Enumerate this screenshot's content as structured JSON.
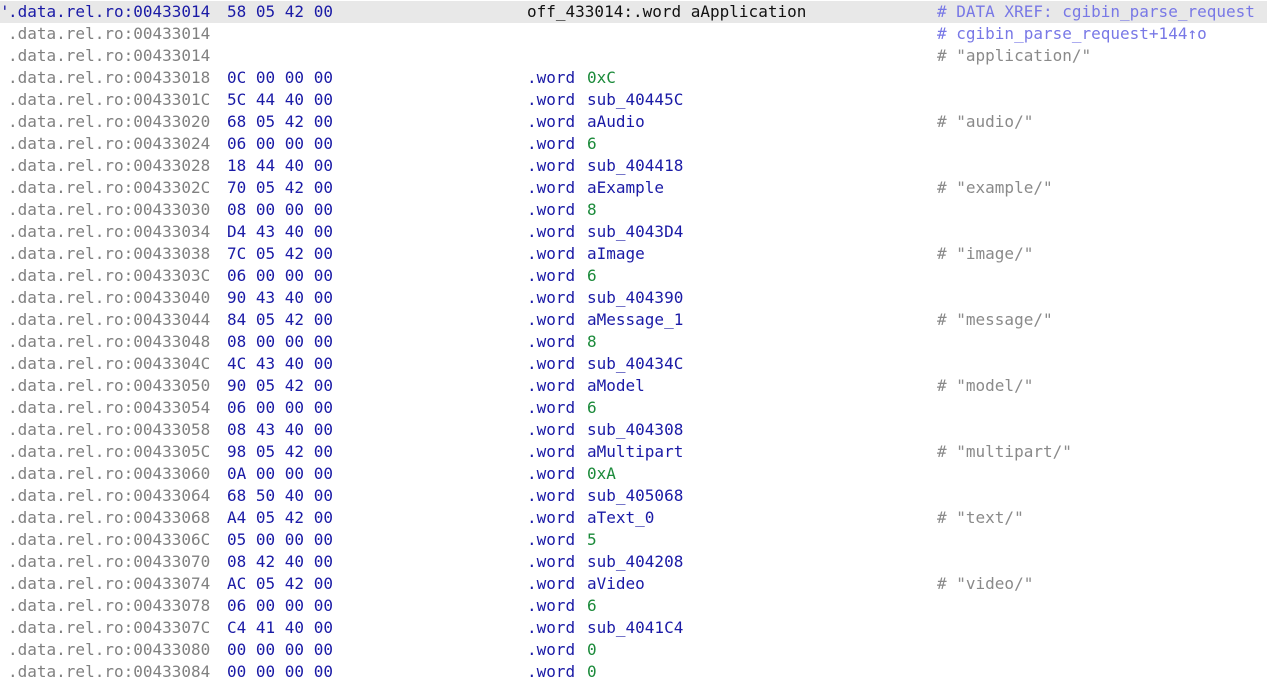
{
  "colors": {
    "address": "#808080",
    "bytes": "#1a1aa6",
    "mnemonic": "#1a1aa6",
    "number_operand": "#1b8a3a",
    "symbol_operand": "#1a1aa6",
    "comment": "#8a8a8a",
    "xref_comment": "#7878e6",
    "selected_row_bg": "#e8e8e8"
  },
  "listing": {
    "rows": [
      {
        "caret": "'",
        "addr": ".data.rel.ro:00433014",
        "bytes": "58 05 42 00",
        "label": "off_433014:.word aApplication",
        "comment": "# DATA XREF: cgibin_parse_request"
      },
      {
        "addr": ".data.rel.ro:00433014",
        "comment": "# cgibin_parse_request+144↑o"
      },
      {
        "addr": ".data.rel.ro:00433014",
        "comment": "# \"application/\""
      },
      {
        "addr": ".data.rel.ro:00433018",
        "bytes": "0C 00 00 00",
        "mnem": ".word",
        "op": "0xC"
      },
      {
        "addr": ".data.rel.ro:0043301C",
        "bytes": "5C 44 40 00",
        "mnem": ".word",
        "op": "sub_40445C"
      },
      {
        "addr": ".data.rel.ro:00433020",
        "bytes": "68 05 42 00",
        "mnem": ".word",
        "op": "aAudio",
        "comment": "# \"audio/\""
      },
      {
        "addr": ".data.rel.ro:00433024",
        "bytes": "06 00 00 00",
        "mnem": ".word",
        "op": "6"
      },
      {
        "addr": ".data.rel.ro:00433028",
        "bytes": "18 44 40 00",
        "mnem": ".word",
        "op": "sub_404418"
      },
      {
        "addr": ".data.rel.ro:0043302C",
        "bytes": "70 05 42 00",
        "mnem": ".word",
        "op": "aExample",
        "comment": "# \"example/\""
      },
      {
        "addr": ".data.rel.ro:00433030",
        "bytes": "08 00 00 00",
        "mnem": ".word",
        "op": "8"
      },
      {
        "addr": ".data.rel.ro:00433034",
        "bytes": "D4 43 40 00",
        "mnem": ".word",
        "op": "sub_4043D4"
      },
      {
        "addr": ".data.rel.ro:00433038",
        "bytes": "7C 05 42 00",
        "mnem": ".word",
        "op": "aImage",
        "comment": "# \"image/\""
      },
      {
        "addr": ".data.rel.ro:0043303C",
        "bytes": "06 00 00 00",
        "mnem": ".word",
        "op": "6"
      },
      {
        "addr": ".data.rel.ro:00433040",
        "bytes": "90 43 40 00",
        "mnem": ".word",
        "op": "sub_404390"
      },
      {
        "addr": ".data.rel.ro:00433044",
        "bytes": "84 05 42 00",
        "mnem": ".word",
        "op": "aMessage_1",
        "comment": "# \"message/\""
      },
      {
        "addr": ".data.rel.ro:00433048",
        "bytes": "08 00 00 00",
        "mnem": ".word",
        "op": "8"
      },
      {
        "addr": ".data.rel.ro:0043304C",
        "bytes": "4C 43 40 00",
        "mnem": ".word",
        "op": "sub_40434C"
      },
      {
        "addr": ".data.rel.ro:00433050",
        "bytes": "90 05 42 00",
        "mnem": ".word",
        "op": "aModel",
        "comment": "# \"model/\""
      },
      {
        "addr": ".data.rel.ro:00433054",
        "bytes": "06 00 00 00",
        "mnem": ".word",
        "op": "6"
      },
      {
        "addr": ".data.rel.ro:00433058",
        "bytes": "08 43 40 00",
        "mnem": ".word",
        "op": "sub_404308"
      },
      {
        "addr": ".data.rel.ro:0043305C",
        "bytes": "98 05 42 00",
        "mnem": ".word",
        "op": "aMultipart",
        "comment": "# \"multipart/\""
      },
      {
        "addr": ".data.rel.ro:00433060",
        "bytes": "0A 00 00 00",
        "mnem": ".word",
        "op": "0xA"
      },
      {
        "addr": ".data.rel.ro:00433064",
        "bytes": "68 50 40 00",
        "mnem": ".word",
        "op": "sub_405068"
      },
      {
        "addr": ".data.rel.ro:00433068",
        "bytes": "A4 05 42 00",
        "mnem": ".word",
        "op": "aText_0",
        "comment": "# \"text/\""
      },
      {
        "addr": ".data.rel.ro:0043306C",
        "bytes": "05 00 00 00",
        "mnem": ".word",
        "op": "5"
      },
      {
        "addr": ".data.rel.ro:00433070",
        "bytes": "08 42 40 00",
        "mnem": ".word",
        "op": "sub_404208"
      },
      {
        "addr": ".data.rel.ro:00433074",
        "bytes": "AC 05 42 00",
        "mnem": ".word",
        "op": "aVideo",
        "comment": "# \"video/\""
      },
      {
        "addr": ".data.rel.ro:00433078",
        "bytes": "06 00 00 00",
        "mnem": ".word",
        "op": "6"
      },
      {
        "addr": ".data.rel.ro:0043307C",
        "bytes": "C4 41 40 00",
        "mnem": ".word",
        "op": "sub_4041C4"
      },
      {
        "addr": ".data.rel.ro:00433080",
        "bytes": "00 00 00 00",
        "mnem": ".word",
        "op": "0"
      },
      {
        "addr": ".data.rel.ro:00433084",
        "bytes": "00 00 00 00",
        "mnem": ".word",
        "op": "0"
      }
    ]
  }
}
